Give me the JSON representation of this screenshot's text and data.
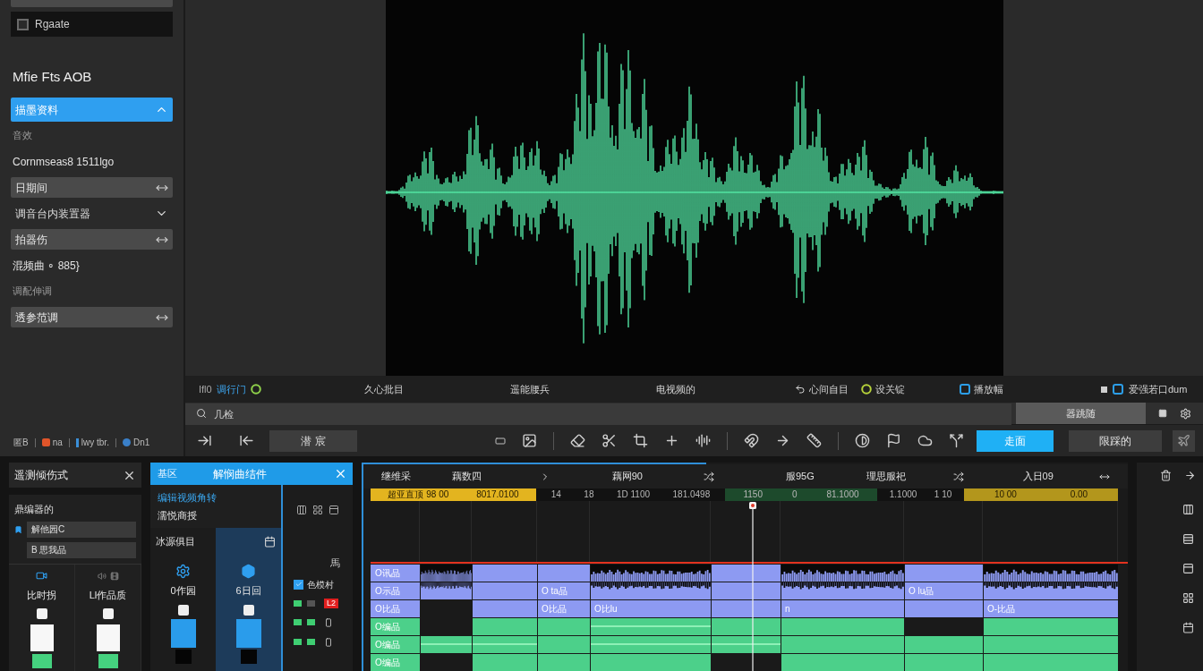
{
  "sidebar": {
    "checkbox": {
      "label": "Rgaate",
      "checked": false
    },
    "heading": "Mfie Fts AOB",
    "items": [
      {
        "kind": "dropdown",
        "label": "描墨资料",
        "expanded": true
      },
      {
        "kind": "caption",
        "label": "音效"
      },
      {
        "kind": "text",
        "label": "Cornmseas8 1511lgo"
      },
      {
        "kind": "field",
        "value": "日期间"
      },
      {
        "kind": "dropdown",
        "label": "调音台内装置器",
        "expanded": false
      },
      {
        "kind": "field",
        "value": "拍器伤"
      },
      {
        "kind": "text",
        "label": "混频曲 ∘ 885}"
      },
      {
        "kind": "caption",
        "label": "调配伸调"
      },
      {
        "kind": "field",
        "value": "透参范调"
      }
    ],
    "status": [
      {
        "kind": "plain",
        "text": "匿B"
      },
      {
        "kind": "alert",
        "text": "na"
      },
      {
        "kind": "info",
        "text": "lwy tbr."
      },
      {
        "kind": "sync",
        "text": "Dn1"
      }
    ]
  },
  "info_bar": [
    {
      "kind": "accent",
      "prefix": "Ifl0",
      "text": "调行门"
    },
    {
      "kind": "plain",
      "text": "久心批目"
    },
    {
      "kind": "plain",
      "text": "遥能腰兵"
    },
    {
      "kind": "plain",
      "text": "电视频的"
    },
    {
      "kind": "arrow",
      "text": "心间自目"
    },
    {
      "kind": "ring",
      "text": "设关锭"
    },
    {
      "kind": "square",
      "text": "播放幅"
    },
    {
      "kind": "double",
      "text": "爱强若口dum"
    }
  ],
  "search": {
    "placeholder": "几检"
  },
  "filter_button": "器跳随",
  "tool_button": "潜 宸",
  "actions": [
    {
      "label": "走面",
      "selected": true
    },
    {
      "label": "限踩的",
      "selected": false
    }
  ],
  "effects_panel": {
    "title": "遥测倾伤式",
    "label": "鼎编器的",
    "fields": [
      {
        "value": "解他园C"
      },
      {
        "value": "B 思我品"
      }
    ],
    "channels": [
      {
        "name": "比时拐"
      },
      {
        "name": "Ll作品质"
      }
    ]
  },
  "mixer_panel": {
    "tag": "基区",
    "title": "解悯曲结件",
    "subtitle": "编辑视频角转",
    "label": "濡悦商授",
    "section": "冰源俱目",
    "channels": [
      {
        "name": "0作园",
        "selected": false
      },
      {
        "name": "6日回",
        "selected": true
      }
    ],
    "side": {
      "label": "馬",
      "checkbox": {
        "label": "色模村",
        "checked": true
      },
      "rows": [
        {
          "leds": [
            {
              "on": true
            },
            {
              "on": false
            }
          ],
          "tag": "L2"
        },
        {
          "leds": [
            {
              "on": true
            },
            {
              "on": true
            }
          ]
        },
        {
          "leds": [
            {
              "on": true
            },
            {
              "on": true
            }
          ]
        }
      ]
    }
  },
  "timeline": {
    "headers": [
      "继维采",
      "藕数四",
      "藕网90",
      "服95G",
      "理思服祀",
      "入日09"
    ],
    "ruler": [
      {
        "color": "#e3b41f",
        "texts": [
          "超亚直顶 98 00",
          "8017.0100"
        ]
      },
      {
        "color": "#121212",
        "texts": [
          "14",
          "18",
          "1D 1100",
          "181.0498"
        ]
      },
      {
        "color": "#1d4a2c",
        "texts": [
          "1150",
          "0",
          "81.1000"
        ]
      },
      {
        "color": "#121212",
        "texts": [
          "1.1000",
          "1 10"
        ]
      },
      {
        "color": "#b3961c",
        "texts": [
          "10 00",
          "0.00"
        ]
      }
    ],
    "tracks": [
      {
        "kind": "audio",
        "label": "O讯品",
        "cells": [
          {
            "kind": "waveform"
          },
          {
            "kind": "clip"
          },
          {
            "kind": "clip"
          },
          {
            "kind": "waveform"
          },
          {
            "kind": "clip"
          },
          {
            "kind": "waveform"
          },
          {
            "kind": "clip"
          },
          {
            "kind": "waveform"
          }
        ]
      },
      {
        "kind": "audio",
        "label": "O示品",
        "cells": [
          {
            "kind": "clip_wave"
          },
          {
            "kind": "clip"
          },
          {
            "kind": "clip",
            "text": "O ta品"
          },
          {
            "kind": "clip_wave"
          },
          {
            "kind": "clip"
          },
          {
            "kind": "clip_wave"
          },
          {
            "kind": "clip",
            "text": "O lu品"
          },
          {
            "kind": "clip_wave"
          }
        ]
      },
      {
        "kind": "audio",
        "label": "O比品",
        "cells": [
          {
            "kind": "gap"
          },
          {
            "kind": "clip"
          },
          {
            "kind": "clip",
            "text": "O比品"
          },
          {
            "kind": "clip",
            "text": "O比lu"
          },
          {
            "kind": "clip"
          },
          {
            "kind": "clip",
            "text": "n"
          },
          {
            "kind": "clip"
          },
          {
            "kind": "clip",
            "text": "O-比品"
          }
        ]
      },
      {
        "kind": "video",
        "label": "O编品",
        "cells": [
          {
            "kind": "gap"
          },
          {
            "kind": "clip"
          },
          {
            "kind": "clip"
          },
          {
            "kind": "clip_line"
          },
          {
            "kind": "clip"
          },
          {
            "kind": "clip"
          },
          {
            "kind": "gap"
          },
          {
            "kind": "clip"
          }
        ]
      },
      {
        "kind": "video",
        "label": "O编品",
        "cells": [
          {
            "kind": "clip_line"
          },
          {
            "kind": "clip_line"
          },
          {
            "kind": "clip"
          },
          {
            "kind": "clip_line"
          },
          {
            "kind": "clip_line"
          },
          {
            "kind": "clip"
          },
          {
            "kind": "clip"
          },
          {
            "kind": "clip"
          }
        ]
      },
      {
        "kind": "video",
        "label": "O编品",
        "cells": [
          {
            "kind": "gap"
          },
          {
            "kind": "clip"
          },
          {
            "kind": "clip"
          },
          {
            "kind": "clip"
          },
          {
            "kind": "gap"
          },
          {
            "kind": "clip"
          },
          {
            "kind": "clip"
          },
          {
            "kind": "clip"
          }
        ]
      }
    ]
  }
}
